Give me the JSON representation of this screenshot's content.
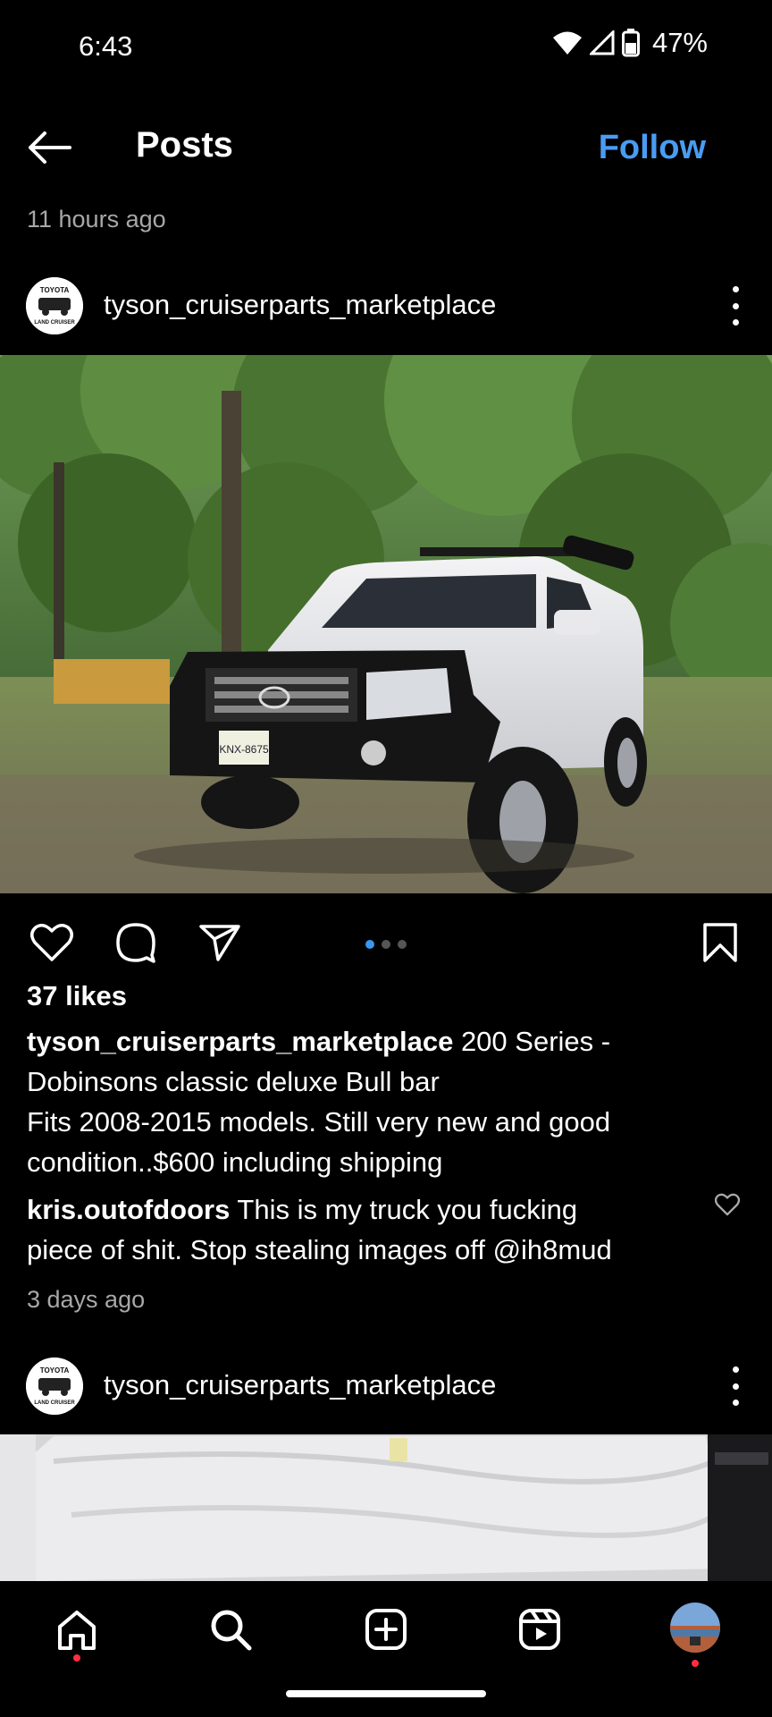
{
  "status": {
    "time": "6:43",
    "battery": "47%"
  },
  "header": {
    "title": "Posts",
    "follow_label": "Follow"
  },
  "top_time_ago": "11 hours ago",
  "posts": [
    {
      "username": "tyson_cruiserparts_marketplace",
      "avatar_text_top": "TOYOTA",
      "avatar_text_bottom": "LAND CRUISER",
      "plate_text": "KNX-8675",
      "likes": "37 likes",
      "caption_user": "tyson_cruiserparts_marketplace",
      "caption_lines": [
        "200 Series -",
        "Dobinsons classic deluxe Bull bar",
        "Fits 2008-2015 models. Still very new and good",
        "condition..$600 including shipping"
      ],
      "comment": {
        "user": "kris.outofdoors",
        "text": "This is my truck you fucking",
        "text_line2": "piece of shit. Stop stealing images off @ih8mud"
      },
      "time_ago": "3 days ago",
      "carousel": {
        "count": 3,
        "active": 0
      }
    },
    {
      "username": "tyson_cruiserparts_marketplace",
      "avatar_text_top": "TOYOTA",
      "avatar_text_bottom": "LAND CRUISER"
    }
  ],
  "nav": {
    "items": [
      "home-icon",
      "search-icon",
      "create-icon",
      "reels-icon",
      "profile-avatar"
    ],
    "active": "home",
    "accent": "#ff3040"
  },
  "colors": {
    "follow": "#4a9cf2",
    "carousel_active": "#3897f0"
  }
}
